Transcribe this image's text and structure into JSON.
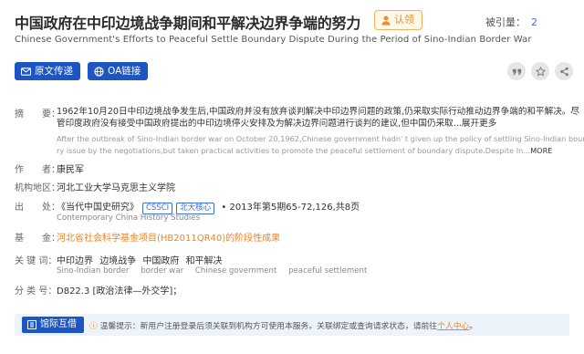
{
  "header": {
    "title": "中国政府在中印边境战争期间和平解决边界争端的努力",
    "claim_label": "认领",
    "cited_label": "被引量：",
    "cited_count": "2",
    "subtitle": "Chinese Government's Efforts to Peaceful Settle Boundary Dispute During the Period of Sino-Indian Border War"
  },
  "actions": {
    "fulltext_label": "原文传递",
    "oa_label": "OA链接",
    "icons": [
      "quote-icon",
      "star-icon",
      "share-icon"
    ]
  },
  "abstract": {
    "label": "摘　　要：",
    "cn_line1": "1962年10月20日中印边境战争发生后,中国政府并没有放弃谈判解决中印边界问题的政策,仍采取实际行动推动边界争端的和平解决。尽",
    "cn_line2": "管印度政府没有接受中国政府提出的中印边境停火安排及为解决边界问题进行谈判的建议,但中国仍采取...展开更多",
    "en_line1": "After the outbreak of Sino-Indian border war on October 20,1962,Chinese government hadn' t given up the policy of settling Sino-Indian bounda",
    "en_line2": "ry issue by the negotiations,but taken practical activities to promote the peaceful settlement of boundary dispute.Despite In...",
    "en_more": "MORE"
  },
  "author": {
    "label": "作　　者：",
    "name": "康民军"
  },
  "affiliation": {
    "label": "机构地区：",
    "value": "河北工业大学马克思主义学院"
  },
  "source": {
    "label": "出　　处：",
    "journal": "《当代中国史研究》",
    "badge1": "CSSCI",
    "badge2": "北大核心",
    "issue": "• 2013年第5期65-72,126,共8页",
    "journal_en": "Contemporary China History Studies"
  },
  "fund": {
    "label": "基　　金：",
    "value": "河北省社会科学基金项目(HB2011QR40)的阶段性成果"
  },
  "keywords": {
    "label": "关 键 词：",
    "cn": [
      "中印边界",
      "边境战争",
      "中国政府",
      "和平解决"
    ],
    "en": [
      "Sino-Indian border",
      "border war",
      "Chinese government",
      "peaceful settlement"
    ]
  },
  "classification": {
    "label": "分 类 号：",
    "value": "D822.3 [政治法律—外交学]；"
  },
  "bottom": {
    "button_label": "馆际互借",
    "tip_prefix": "温馨提示：",
    "tip_text": "新用户注册登录后须关联到机构方可使用本服务。关联绑定或查询请求状态，请前往",
    "tip_link": "个人中心",
    "tip_end": "。"
  },
  "colors": {
    "brand_blue": "#1d56c2",
    "accent_orange": "#e6862a",
    "link_blue": "#3a6fd8"
  }
}
